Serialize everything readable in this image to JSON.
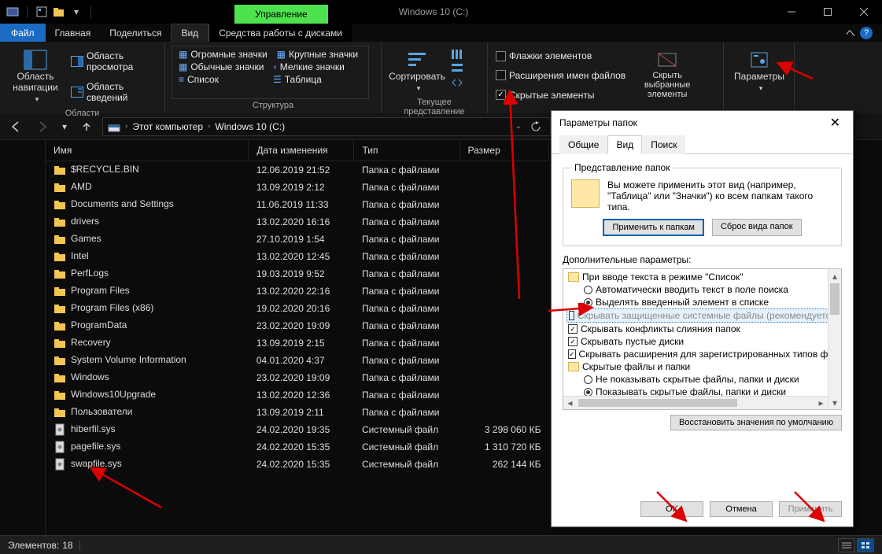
{
  "window": {
    "title": "Windows 10 (C:)",
    "context_tab": "Управление",
    "context_label": "Средства работы с дисками"
  },
  "tabs": {
    "file": "Файл",
    "home": "Главная",
    "share": "Поделиться",
    "view": "Вид"
  },
  "ribbon": {
    "panes": {
      "nav_pane": "Область навигации",
      "preview": "Область просмотра",
      "details": "Область сведений",
      "caption": "Области"
    },
    "layout": {
      "extra_large": "Огромные значки",
      "large": "Крупные значки",
      "medium": "Обычные значки",
      "small": "Мелкие значки",
      "list": "Список",
      "details": "Таблица",
      "caption": "Структура"
    },
    "current_view": {
      "sort": "Сортировать",
      "caption": "Текущее представление"
    },
    "show_hide": {
      "checkboxes": "Флажки элементов",
      "extensions": "Расширения имен файлов",
      "hidden": "Скрытые элементы",
      "hide_selected": "Скрыть выбранные элементы"
    },
    "options": "Параметры"
  },
  "breadcrumbs": [
    "Этот компьютер",
    "Windows 10 (C:)"
  ],
  "columns": {
    "name": "Имя",
    "date": "Дата изменения",
    "type": "Тип",
    "size": "Размер"
  },
  "type_labels": {
    "folder": "Папка с файлами",
    "sysfile": "Системный файл"
  },
  "files": [
    {
      "name": "$RECYCLE.BIN",
      "date": "12.06.2019 21:52",
      "type": "folder",
      "size": ""
    },
    {
      "name": "AMD",
      "date": "13.09.2019 2:12",
      "type": "folder",
      "size": ""
    },
    {
      "name": "Documents and Settings",
      "date": "11.06.2019 11:33",
      "type": "folder",
      "size": ""
    },
    {
      "name": "drivers",
      "date": "13.02.2020 16:16",
      "type": "folder",
      "size": ""
    },
    {
      "name": "Games",
      "date": "27.10.2019 1:54",
      "type": "folder",
      "size": ""
    },
    {
      "name": "Intel",
      "date": "13.02.2020 12:45",
      "type": "folder",
      "size": ""
    },
    {
      "name": "PerfLogs",
      "date": "19.03.2019 9:52",
      "type": "folder",
      "size": ""
    },
    {
      "name": "Program Files",
      "date": "13.02.2020 22:16",
      "type": "folder",
      "size": ""
    },
    {
      "name": "Program Files (x86)",
      "date": "19.02.2020 20:16",
      "type": "folder",
      "size": ""
    },
    {
      "name": "ProgramData",
      "date": "23.02.2020 19:09",
      "type": "folder",
      "size": ""
    },
    {
      "name": "Recovery",
      "date": "13.09.2019 2:15",
      "type": "folder",
      "size": ""
    },
    {
      "name": "System Volume Information",
      "date": "04.01.2020 4:37",
      "type": "folder",
      "size": ""
    },
    {
      "name": "Windows",
      "date": "23.02.2020 19:09",
      "type": "folder",
      "size": ""
    },
    {
      "name": "Windows10Upgrade",
      "date": "13.02.2020 12:36",
      "type": "folder",
      "size": ""
    },
    {
      "name": "Пользователи",
      "date": "13.09.2019 2:11",
      "type": "folder",
      "size": ""
    },
    {
      "name": "hiberfil.sys",
      "date": "24.02.2020 19:35",
      "type": "sysfile",
      "size": "3 298 060 КБ"
    },
    {
      "name": "pagefile.sys",
      "date": "24.02.2020 15:35",
      "type": "sysfile",
      "size": "1 310 720 КБ"
    },
    {
      "name": "swapfile.sys",
      "date": "24.02.2020 15:35",
      "type": "sysfile",
      "size": "262 144 КБ"
    }
  ],
  "statusbar": {
    "label": "Элементов:",
    "count": "18"
  },
  "dialog": {
    "title": "Параметры папок",
    "tabs": {
      "general": "Общие",
      "view": "Вид",
      "search": "Поиск"
    },
    "folder_views": {
      "legend": "Представление папок",
      "desc": "Вы можете применить этот вид (например, \"Таблица\" или \"Значки\") ко всем папкам такого типа.",
      "apply": "Применить к папкам",
      "reset": "Сброс вида папок"
    },
    "advanced_label": "Дополнительные параметры:",
    "tree": {
      "g1": "При вводе текста в режиме \"Список\"",
      "g1_o1": "Автоматически вводить текст в поле поиска",
      "g1_o2": "Выделять введенный элемент в списке",
      "c1": "Скрывать защищенные системные файлы (рекомендуется)",
      "c2": "Скрывать конфликты слияния папок",
      "c3": "Скрывать пустые диски",
      "c4": "Скрывать расширения для зарегистрированных типов файлов",
      "g2": "Скрытые файлы и папки",
      "g2_o1": "Не показывать скрытые файлы, папки и диски",
      "g2_o2": "Показывать скрытые файлы, папки и диски"
    },
    "restore": "Восстановить значения по умолчанию",
    "ok": "OK",
    "cancel": "Отмена",
    "apply": "Применить"
  }
}
